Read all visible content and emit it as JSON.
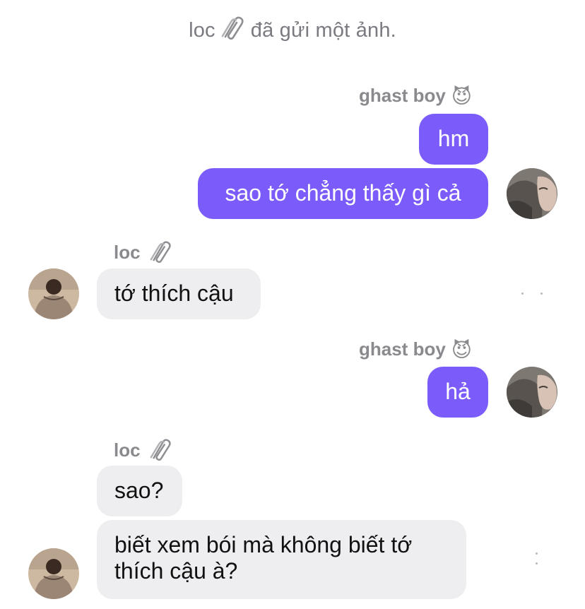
{
  "system_message": {
    "name": "loc",
    "icon": "paperclip-icon",
    "text": "đã gửi một ảnh."
  },
  "colors": {
    "outgoing_bubble": "#7b5cfa",
    "incoming_bubble": "#eeeef0",
    "meta_text": "#8a8a8e"
  },
  "messages": [
    {
      "sender": "ghast boy",
      "sender_emoji": "😈",
      "direction": "outgoing",
      "bubbles": [
        "hm",
        "sao tớ chẳng thấy gì cả"
      ]
    },
    {
      "sender": "loc",
      "sender_icon": "paperclip-icon",
      "direction": "incoming",
      "bubbles": [
        "tớ thích cậu"
      ]
    },
    {
      "sender": "ghast boy",
      "sender_emoji": "😈",
      "direction": "outgoing",
      "bubbles": [
        "hả"
      ]
    },
    {
      "sender": "loc",
      "sender_icon": "paperclip-icon",
      "direction": "incoming",
      "bubbles": [
        "sao?",
        "biết xem bói mà không biết tớ",
        "thích cậu à?"
      ]
    }
  ]
}
